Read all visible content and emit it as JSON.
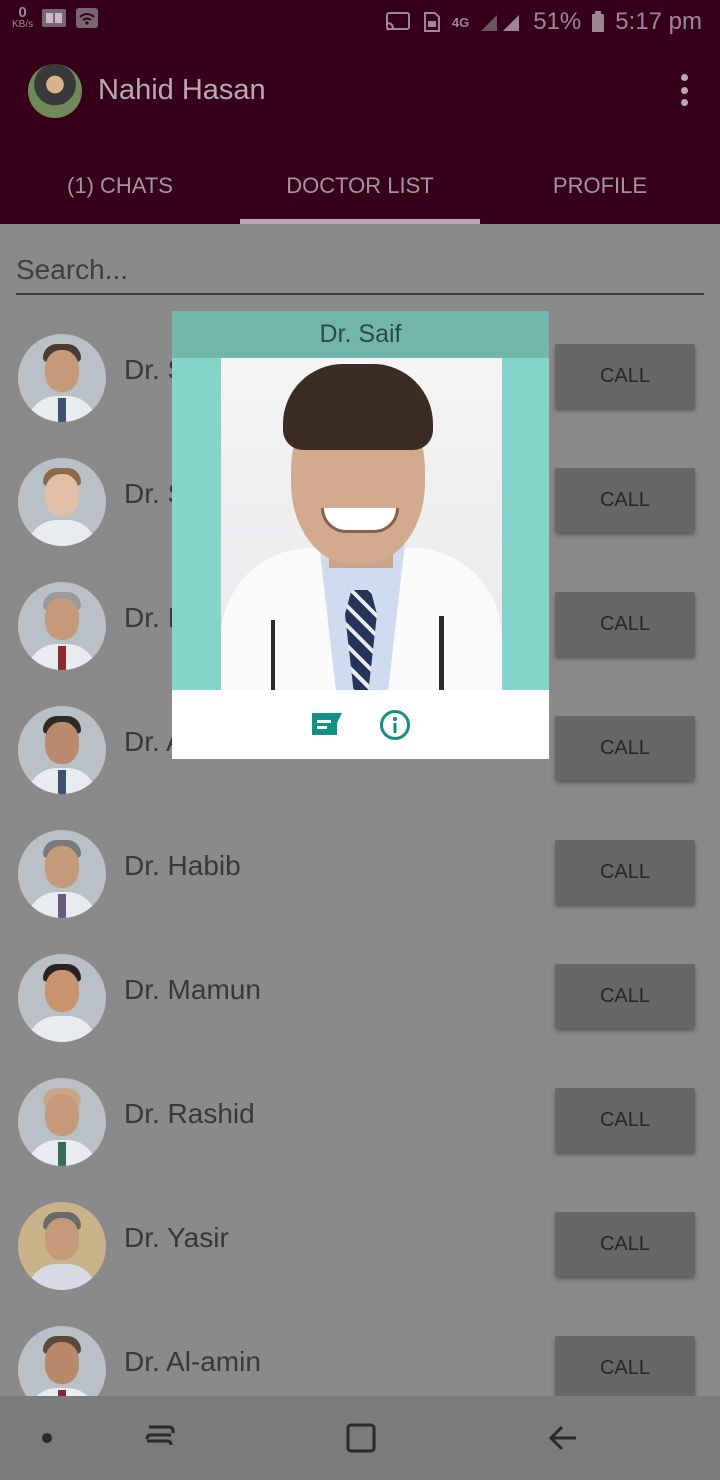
{
  "status_bar": {
    "speed_value": "0",
    "speed_unit": "KB/s",
    "network": "4G",
    "battery": "51%",
    "time": "5:17 pm"
  },
  "app_bar": {
    "user_name": "Nahid Hasan"
  },
  "tabs": [
    {
      "label": "(1) CHATS",
      "active": false
    },
    {
      "label": "DOCTOR LIST",
      "active": true
    },
    {
      "label": "PROFILE",
      "active": false
    }
  ],
  "search": {
    "placeholder": "Search..."
  },
  "call_label": "CALL",
  "doctors": [
    {
      "name": "Dr. S"
    },
    {
      "name": "Dr. S"
    },
    {
      "name": "Dr. I"
    },
    {
      "name": "Dr. Ahsan Habib"
    },
    {
      "name": "Dr. Habib"
    },
    {
      "name": "Dr. Mamun"
    },
    {
      "name": "Dr. Rashid"
    },
    {
      "name": "Dr. Yasir"
    },
    {
      "name": "Dr. Al-amin"
    }
  ],
  "popup": {
    "title": "Dr. Saif",
    "accent_color": "#138f85"
  },
  "colors": {
    "primary_dark": "#37001a",
    "call_button": "#676767"
  }
}
